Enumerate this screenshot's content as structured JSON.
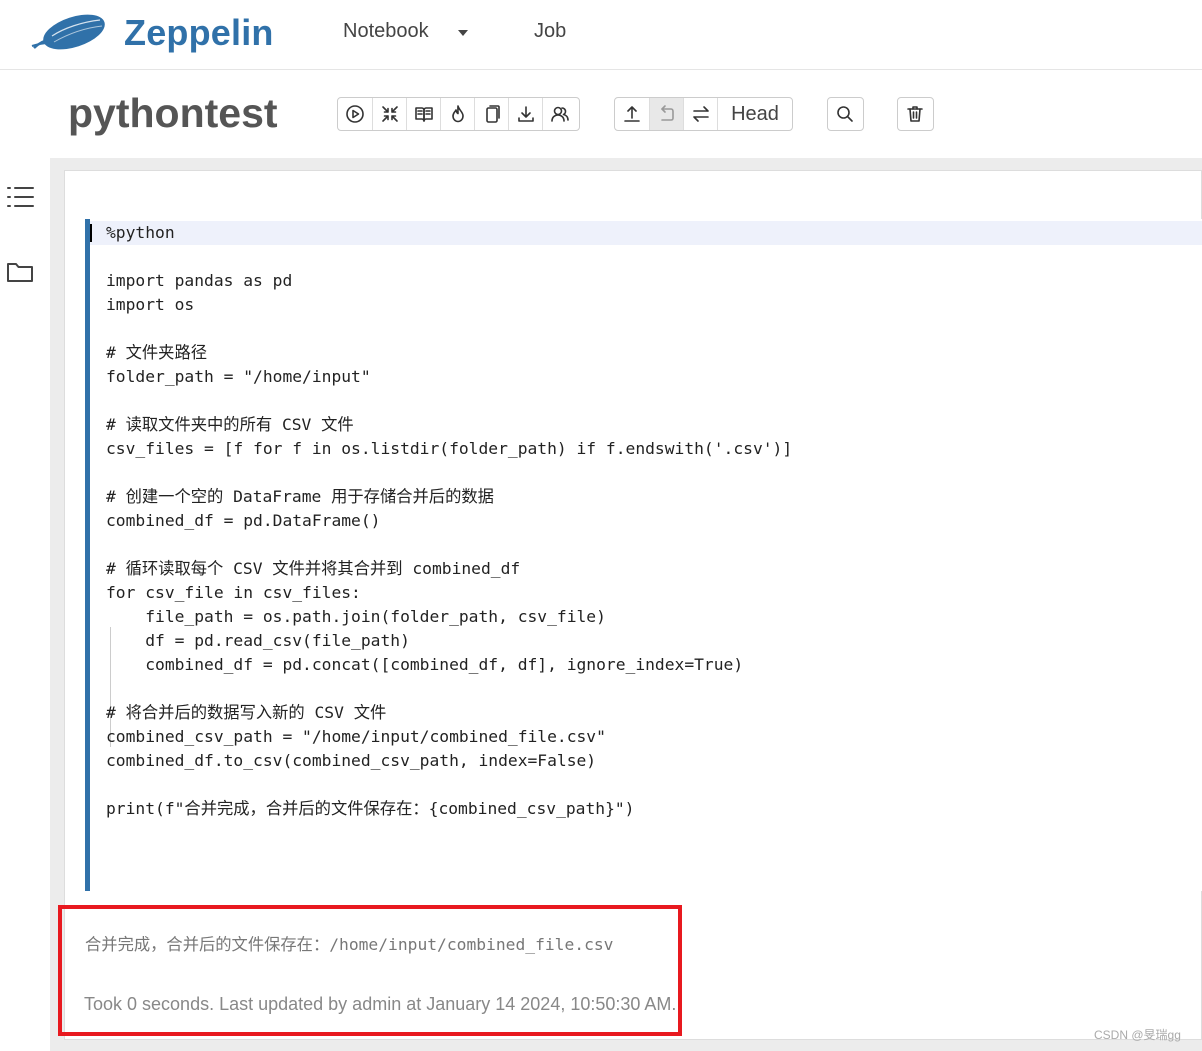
{
  "navbar": {
    "brand": "Zeppelin",
    "notebook_menu": "Notebook",
    "job_link": "Job"
  },
  "notebook": {
    "title": "pythontest",
    "toolbar": {
      "run_all_icon": "play-circle-icon",
      "hide_code_icon": "collapse-arrows-icon",
      "hide_output_icon": "book-icon",
      "clear_output_icon": "eraser-icon",
      "clone_icon": "copy-icon",
      "export_icon": "download-icon",
      "permissions_icon": "users-icon",
      "version_commit_icon": "upload-icon",
      "revert_icon": "undo-icon",
      "compare_icon": "swap-icon",
      "head_label": "Head",
      "search_icon": "search-icon",
      "delete_icon": "trash-icon"
    }
  },
  "sidebar": {
    "toc_icon": "list-icon",
    "files_icon": "folder-icon"
  },
  "paragraph": {
    "code": "%python\n\nimport pandas as pd\nimport os\n\n# 文件夹路径\nfolder_path = \"/home/input\"\n\n# 读取文件夹中的所有 CSV 文件\ncsv_files = [f for f in os.listdir(folder_path) if f.endswith('.csv')]\n\n# 创建一个空的 DataFrame 用于存储合并后的数据\ncombined_df = pd.DataFrame()\n\n# 循环读取每个 CSV 文件并将其合并到 combined_df\nfor csv_file in csv_files:\n    file_path = os.path.join(folder_path, csv_file)\n    df = pd.read_csv(file_path)\n    combined_df = pd.concat([combined_df, df], ignore_index=True)\n\n# 将合并后的数据写入新的 CSV 文件\ncombined_csv_path = \"/home/input/combined_file.csv\"\ncombined_df.to_csv(combined_csv_path, index=False)\n\nprint(f\"合并完成，合并后的文件保存在：{combined_csv_path}\")",
    "output": "合并完成，合并后的文件保存在：/home/input/combined_file.csv",
    "status": "Took 0 seconds. Last updated by admin at January 14 2024, 10:50:30 AM."
  },
  "watermark": "CSDN @旻瑞gg",
  "colors": {
    "brand": "#3071a9",
    "highlight_box": "#e8191f",
    "active_line": "#eef1fb"
  }
}
